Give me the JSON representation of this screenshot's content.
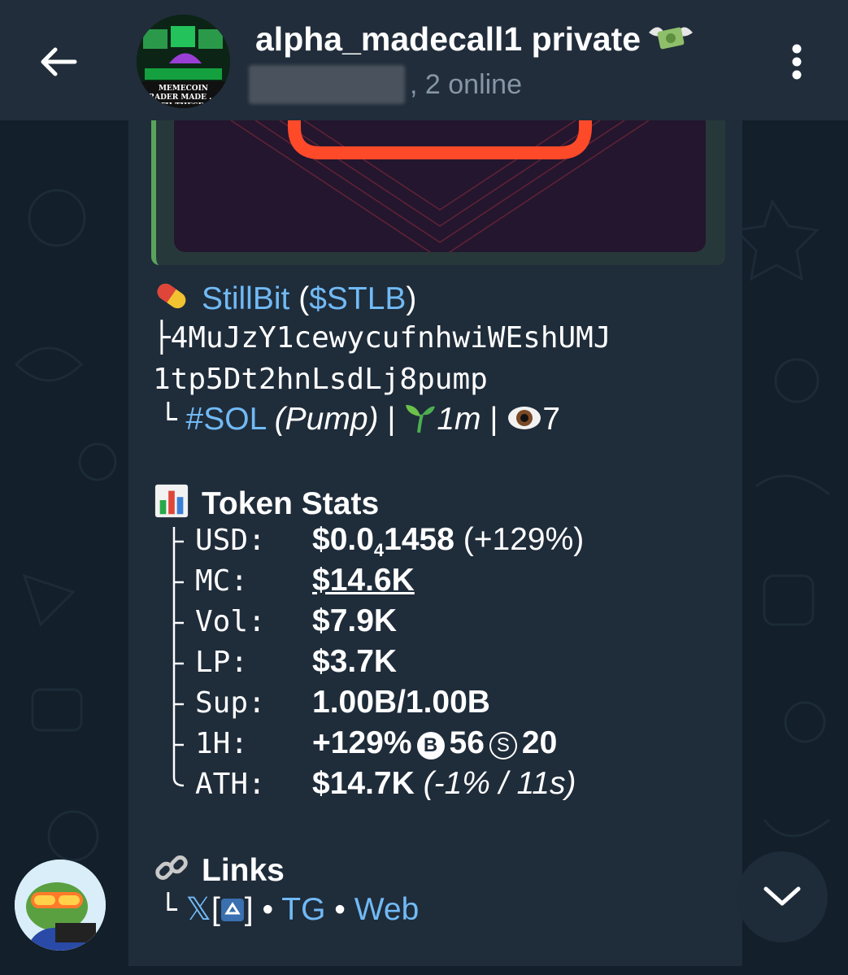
{
  "header": {
    "title": "alpha_madecall1 private",
    "title_emoji": "money-with-wings-emoji",
    "online_text": ", 2 online",
    "avatar_text": "MEMECOIN TRADER MADE ...% WITH THESE T..."
  },
  "message": {
    "token_emoji": "pill-emoji",
    "token_name": "StillBit",
    "token_ticker": "$STLB",
    "contract_line1": "├4MuJzY1cewycufnhwiWEshUMJ",
    "contract_line2": "1tp5Dt2hnLsdLj8pump",
    "chain_prefix": "└",
    "chain_tag": "#SOL",
    "chain_platform": "(Pump)",
    "sep": "|",
    "age": "1m",
    "views": "7",
    "stats_title": "Token Stats",
    "stats": {
      "usd_label": "USD:",
      "usd_main": "$0.0",
      "usd_sub": "4",
      "usd_tail": "1458",
      "usd_change": "(+129%)",
      "mc_label": "MC:",
      "mc_value": "$14.6K",
      "vol_label": "Vol:",
      "vol_value": "$7.9K",
      "lp_label": "LP:",
      "lp_value": "$3.7K",
      "sup_label": "Sup:",
      "sup_value": "1.00B/1.00B",
      "h1_label": "1H:",
      "h1_change": "+129%",
      "h1_buys_icon": "B",
      "h1_buys": "56",
      "h1_sells_icon": "S",
      "h1_sells": "20",
      "ath_label": "ATH:",
      "ath_value": "$14.7K",
      "ath_extra": "(-1% / 11s)"
    },
    "links_title": "Links",
    "links": {
      "prefix": "└",
      "x": "𝕏",
      "x_bracket_open": "[",
      "x_bracket_close": "]",
      "dot1": "•",
      "tg": "TG",
      "dot2": "•",
      "web": "Web"
    }
  },
  "colors": {
    "header_bg": "#212d3b",
    "bubble_bg": "#1f2c3a",
    "link": "#71baf5",
    "accent_green": "#5aa35d"
  }
}
